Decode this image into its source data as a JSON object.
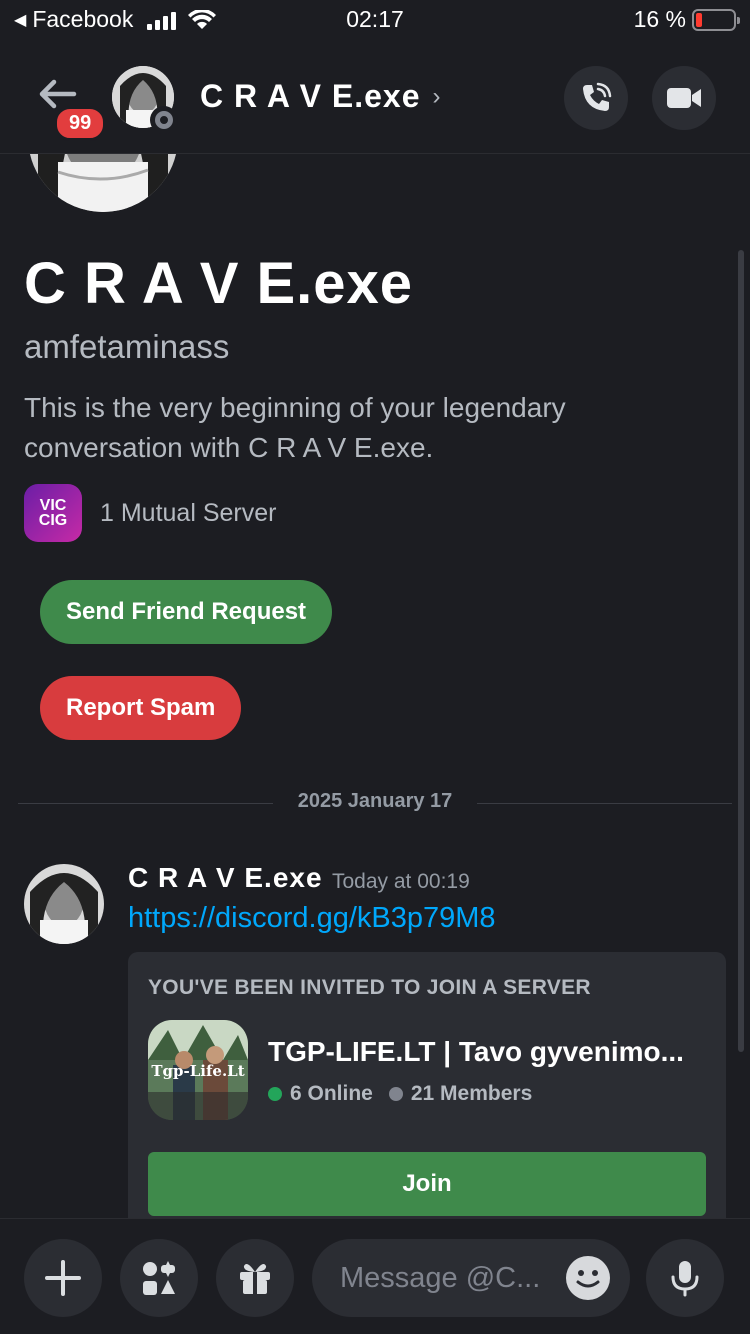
{
  "status_bar": {
    "back_app": "Facebook",
    "time": "02:17",
    "battery": "16 %"
  },
  "header": {
    "badge": "99",
    "title": "C R A V E.exe",
    "title_chevron": "›"
  },
  "profile": {
    "display_name": "C R A V E.exe",
    "username": "amfetaminass",
    "intro": "This is the very beginning of your legendary conversation with C R A V E.exe.",
    "mutual_server_icon_line1": "VIC",
    "mutual_server_icon_line2": "CIG",
    "mutual_servers": "1 Mutual Server",
    "send_friend_request": "Send Friend Request",
    "report_spam": "Report Spam"
  },
  "date_divider": "2025 January 17",
  "message": {
    "author": "C R A V E.exe",
    "timestamp": "Today at 00:19",
    "link": "https://discord.gg/kB3p79M8",
    "invite": {
      "label": "YOU'VE BEEN INVITED TO JOIN A SERVER",
      "server_name": "TGP-LIFE.LT | Tavo gyvenimo...",
      "icon_text": "Tgp-Life.Lt",
      "online": "6 Online",
      "members": "21 Members",
      "join": "Join"
    }
  },
  "composer": {
    "placeholder": "Message @C..."
  },
  "colors": {
    "background": "#1c1d22",
    "green_button": "#3f8a4b",
    "red_button": "#d83c3e",
    "link": "#00a8fc",
    "badge": "#e23d3e"
  },
  "icons": [
    "back-arrow-icon",
    "phone-icon",
    "video-camera-icon",
    "plus-icon",
    "apps-icon",
    "gift-icon",
    "emoji-icon",
    "microphone-icon"
  ]
}
